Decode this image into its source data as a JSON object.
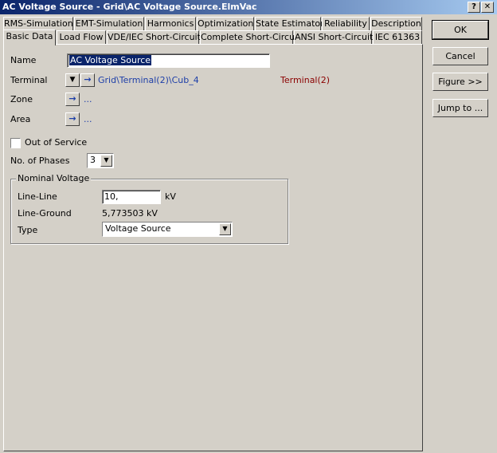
{
  "window": {
    "title": "AC Voltage Source - Grid\\AC Voltage Source.ElmVac",
    "help_label": "?",
    "close_label": "✕"
  },
  "tabs_row1": [
    {
      "label": "RMS-Simulation"
    },
    {
      "label": "EMT-Simulation"
    },
    {
      "label": "Harmonics"
    },
    {
      "label": "Optimization"
    },
    {
      "label": "State Estimator"
    },
    {
      "label": "Reliability"
    },
    {
      "label": "Description"
    }
  ],
  "tabs_row2": [
    {
      "label": "Basic Data"
    },
    {
      "label": "Load Flow"
    },
    {
      "label": "VDE/IEC Short-Circuit"
    },
    {
      "label": "Complete Short-Circuit"
    },
    {
      "label": "ANSI Short-Circuit"
    },
    {
      "label": "IEC 61363"
    }
  ],
  "form": {
    "name_label": "Name",
    "name_value": "AC Voltage Source",
    "terminal_label": "Terminal",
    "terminal_path": "Grid\\Terminal(2)\\Cub_4",
    "terminal_name": "Terminal(2)",
    "zone_label": "Zone",
    "zone_value": "...",
    "area_label": "Area",
    "area_value": "...",
    "out_of_service_label": "Out of Service",
    "out_of_service_checked": false,
    "phases_label": "No. of Phases",
    "phases_value": "3"
  },
  "nominal_voltage": {
    "group_title": "Nominal Voltage",
    "line_line_label": "Line-Line",
    "line_line_value": "10,",
    "line_line_unit": "kV",
    "line_ground_label": "Line-Ground",
    "line_ground_value": "5,773503 kV",
    "type_label": "Type",
    "type_value": "Voltage Source"
  },
  "buttons": {
    "ok": "OK",
    "cancel": "Cancel",
    "figure": "Figure >>",
    "jump_to": "Jump to ..."
  },
  "icons": {
    "arrow_right": "→",
    "arrow_down": "▼"
  },
  "colors": {
    "title_gradient_start": "#0a246a",
    "link_blue": "#1e3fa8",
    "terminal_name_red": "#8b0000"
  }
}
